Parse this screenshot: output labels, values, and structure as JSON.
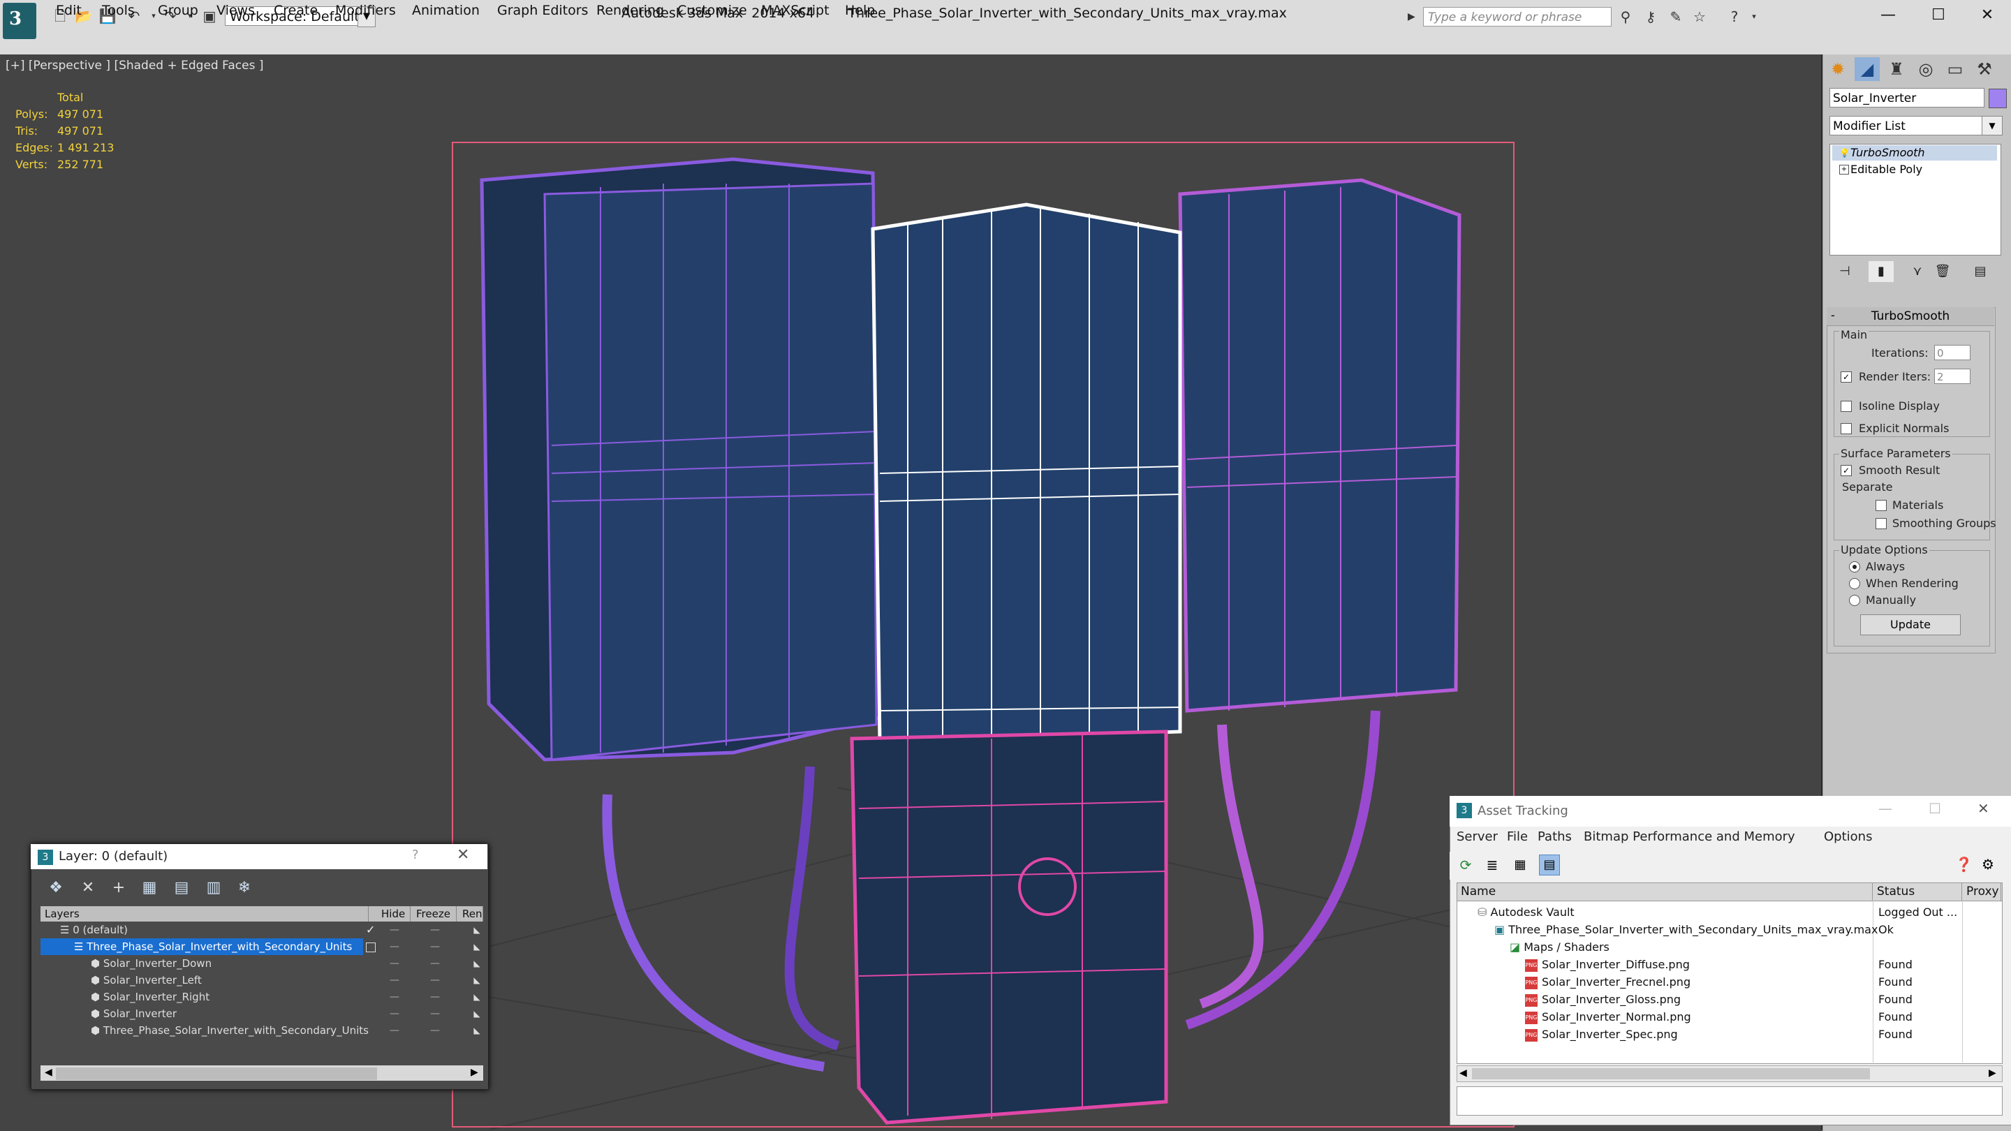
{
  "titlebar": {
    "workspace": "Workspace: Default",
    "app_name": "Autodesk 3ds Max  2014 x64",
    "file_name": "Three_Phase_Solar_Inverter_with_Secondary_Units_max_vray.max",
    "search_placeholder": "Type a keyword or phrase"
  },
  "menubar": [
    "Edit",
    "Tools",
    "Group",
    "Views",
    "Create",
    "Modifiers",
    "Animation",
    "Graph Editors",
    "Rendering",
    "Customize",
    "MAXScript",
    "Help"
  ],
  "viewport": {
    "label": "[+] [Perspective ] [Shaded + Edged Faces ]",
    "stats": {
      "header": "Total",
      "rows": [
        {
          "label": "Polys:",
          "value": "497 071"
        },
        {
          "label": "Tris:",
          "value": "497 071"
        },
        {
          "label": "Edges:",
          "value": "1 491 213"
        },
        {
          "label": "Verts:",
          "value": "252 771"
        }
      ]
    }
  },
  "command_panel": {
    "object_name": "Solar_Inverter",
    "object_color": "#9f82f0",
    "modifier_list": "Modifier List",
    "stack": [
      "TurboSmooth",
      "Editable Poly"
    ],
    "rollout": {
      "title": "TurboSmooth",
      "main": "Main",
      "iterations_label": "Iterations:",
      "iterations_value": "0",
      "render_iters_label": "Render Iters:",
      "render_iters_value": "2",
      "isoline": "Isoline Display",
      "explicit_normals": "Explicit Normals",
      "surface_params": "Surface Parameters",
      "smooth_result": "Smooth Result",
      "separate": "Separate",
      "materials": "Materials",
      "smoothing_groups": "Smoothing Groups",
      "update_options": "Update Options",
      "always": "Always",
      "when_rendering": "When Rendering",
      "manually": "Manually",
      "update_button": "Update"
    }
  },
  "layer_dialog": {
    "title": "Layer: 0 (default)",
    "help": "?",
    "columns": [
      "Layers",
      "Hide",
      "Freeze",
      "Ren"
    ],
    "rows": [
      {
        "name": "0 (default)",
        "indent": 0,
        "selected": false
      },
      {
        "name": "Three_Phase_Solar_Inverter_with_Secondary_Units",
        "indent": 0,
        "selected": true
      },
      {
        "name": "Solar_Inverter_Down",
        "indent": 1,
        "selected": false
      },
      {
        "name": "Solar_Inverter_Left",
        "indent": 1,
        "selected": false
      },
      {
        "name": "Solar_Inverter_Right",
        "indent": 1,
        "selected": false
      },
      {
        "name": "Solar_Inverter",
        "indent": 1,
        "selected": false
      },
      {
        "name": "Three_Phase_Solar_Inverter_with_Secondary_Units",
        "indent": 1,
        "selected": false
      }
    ]
  },
  "asset_tracking": {
    "title": "Asset Tracking",
    "menus": [
      "Server",
      "File",
      "Paths",
      "Bitmap Performance and Memory",
      "Options"
    ],
    "columns": [
      "Name",
      "Status",
      "Proxy"
    ],
    "rows": [
      {
        "name": "Autodesk Vault",
        "status": "Logged Out ...",
        "indent": 0
      },
      {
        "name": "Three_Phase_Solar_Inverter_with_Secondary_Units_max_vray.max",
        "status": "Ok",
        "indent": 1
      },
      {
        "name": "Maps / Shaders",
        "status": "",
        "indent": 2
      },
      {
        "name": "Solar_Inverter_Diffuse.png",
        "status": "Found",
        "indent": 3
      },
      {
        "name": "Solar_Inverter_Frecnel.png",
        "status": "Found",
        "indent": 3
      },
      {
        "name": "Solar_Inverter_Gloss.png",
        "status": "Found",
        "indent": 3
      },
      {
        "name": "Solar_Inverter_Normal.png",
        "status": "Found",
        "indent": 3
      },
      {
        "name": "Solar_Inverter_Spec.png",
        "status": "Found",
        "indent": 3
      }
    ]
  }
}
